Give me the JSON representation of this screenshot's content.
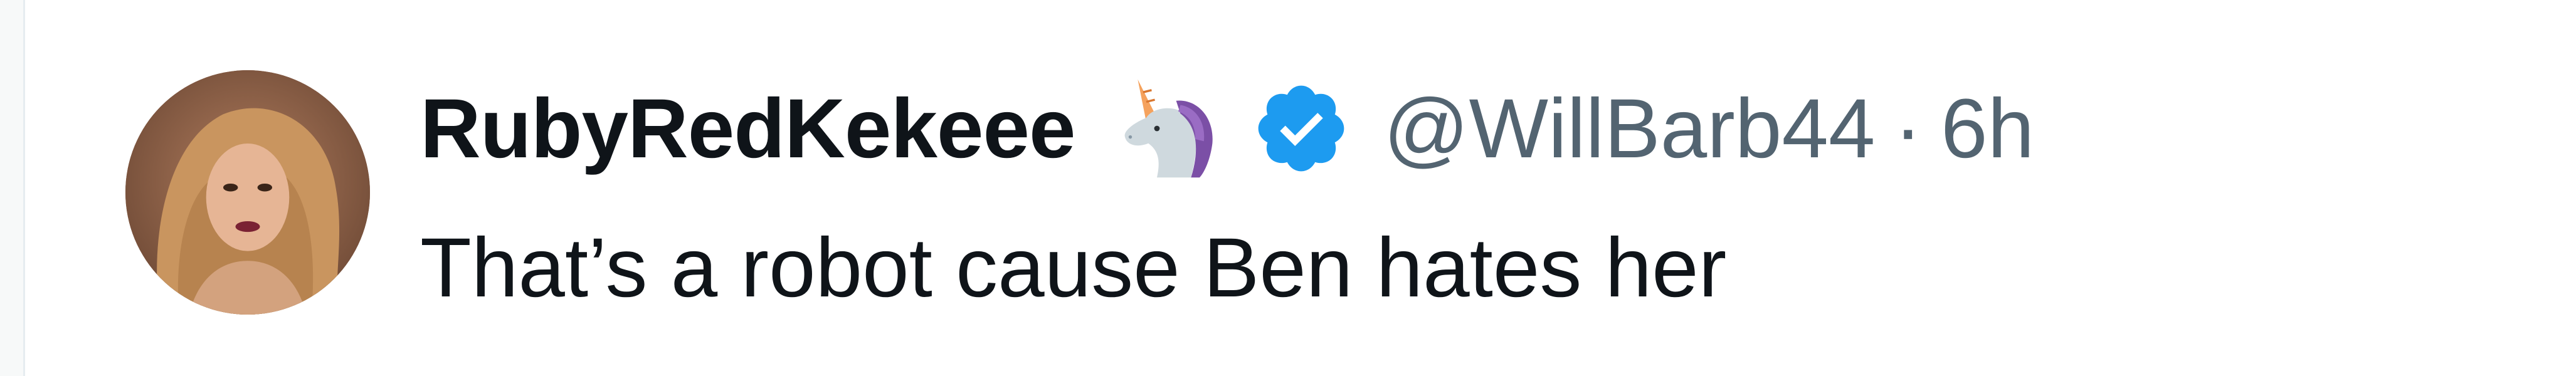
{
  "tweet": {
    "display_name": "RubyRedKekeee",
    "handle": "@WillBarb44",
    "separator": "·",
    "time": "6h",
    "text": "That’s a robot cause Ben hates her"
  },
  "icons": {
    "emoji": "unicorn-icon",
    "badge": "verified-badge-icon",
    "badge_color": "#1d9bf0"
  },
  "colors": {
    "name": "#0f1419",
    "secondary": "#536471",
    "background": "#ffffff"
  }
}
